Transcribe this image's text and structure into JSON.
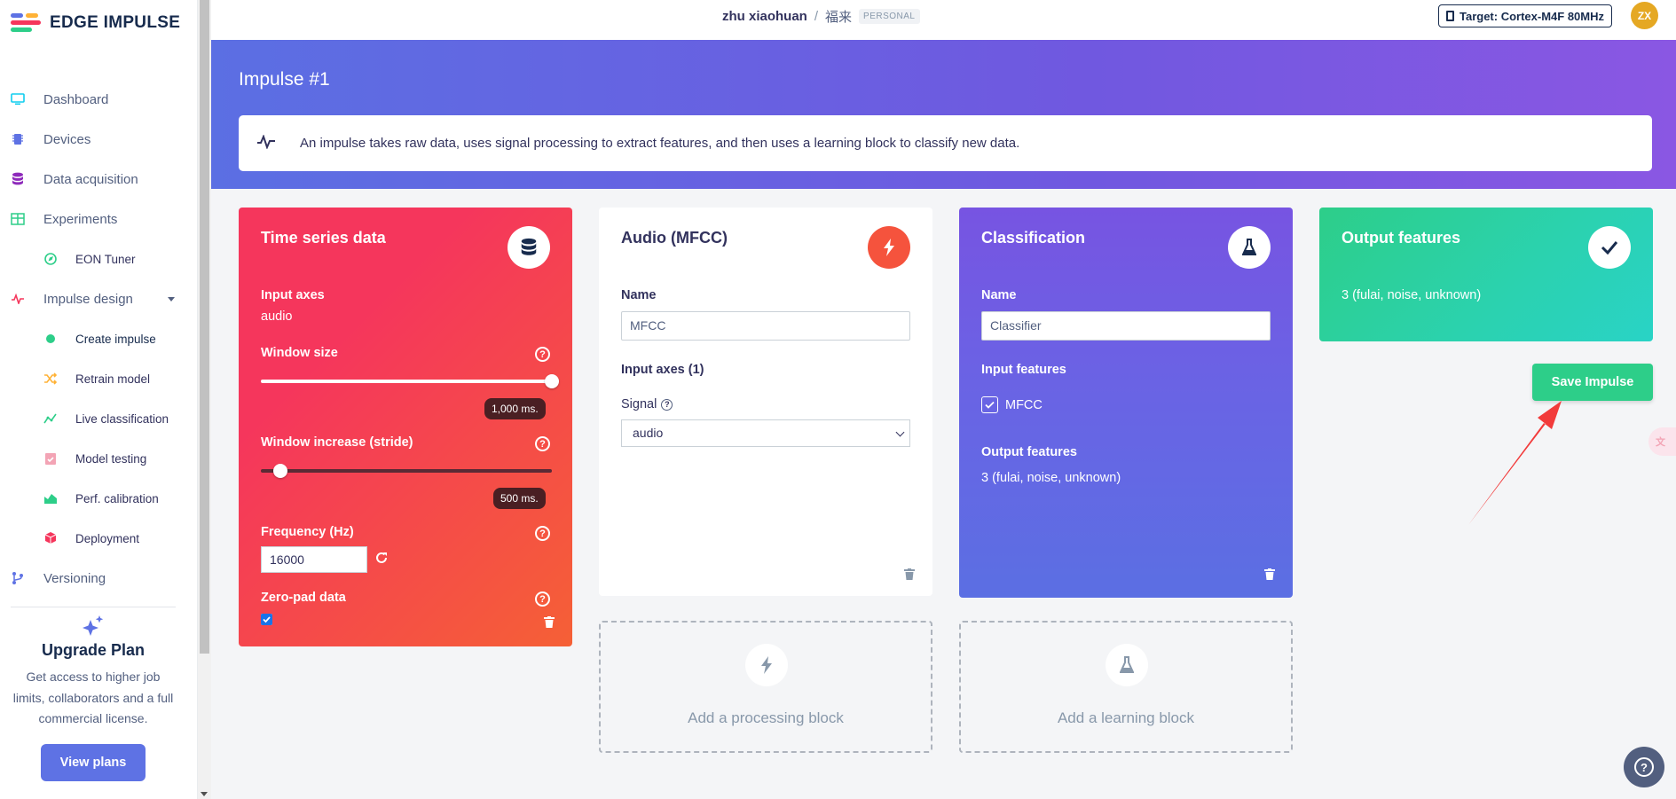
{
  "brand": {
    "name": "EDGE IMPULSE"
  },
  "sidebar": {
    "items": [
      {
        "label": "Dashboard"
      },
      {
        "label": "Devices"
      },
      {
        "label": "Data acquisition"
      },
      {
        "label": "Experiments"
      },
      {
        "label": "EON Tuner"
      },
      {
        "label": "Impulse design"
      },
      {
        "label": "Create impulse"
      },
      {
        "label": "Retrain model"
      },
      {
        "label": "Live classification"
      },
      {
        "label": "Model testing"
      },
      {
        "label": "Perf. calibration"
      },
      {
        "label": "Deployment"
      },
      {
        "label": "Versioning"
      }
    ],
    "upgrade": {
      "title": "Upgrade Plan",
      "text": "Get access to higher job limits, collaborators and a full commercial license.",
      "button": "View plans"
    }
  },
  "header": {
    "user": "zhu xiaohuan",
    "separator": "/",
    "project": "福来",
    "badge": "PERSONAL",
    "target": "Target: Cortex-M4F 80MHz",
    "avatar": "ZX"
  },
  "banner": {
    "title": "Impulse #1",
    "info": "An impulse takes raw data, uses signal processing to extract features, and then uses a learning block to classify new data."
  },
  "time_series": {
    "title": "Time series data",
    "input_axes_label": "Input axes",
    "input_axes_value": "audio",
    "window_size_label": "Window size",
    "window_size_value": "1,000 ms.",
    "window_size_fraction": 1.0,
    "stride_label": "Window increase (stride)",
    "stride_value": "500 ms.",
    "stride_fraction": 0.05,
    "frequency_label": "Frequency (Hz)",
    "frequency_value": "16000",
    "zero_pad_label": "Zero-pad data",
    "zero_pad_checked": true,
    "help": "?"
  },
  "mfcc": {
    "title": "Audio (MFCC)",
    "name_label": "Name",
    "name_value": "MFCC",
    "input_axes_label": "Input axes (1)",
    "signal_label": "Signal",
    "signal_value": "audio"
  },
  "classification": {
    "title": "Classification",
    "name_label": "Name",
    "name_value": "Classifier",
    "input_features_label": "Input features",
    "input_feature": "MFCC",
    "output_features_label": "Output features",
    "output_features_value": "3 (fulai, noise, unknown)"
  },
  "output": {
    "title": "Output features",
    "value": "3 (fulai, noise, unknown)",
    "save_button": "Save Impulse"
  },
  "add_blocks": {
    "processing": "Add a processing block",
    "learning": "Add a learning block"
  },
  "colors": {
    "primary": "#5e72e4",
    "success": "#2dce89",
    "danger": "#f5365c",
    "annotation_arrow": "#f23b3b"
  }
}
